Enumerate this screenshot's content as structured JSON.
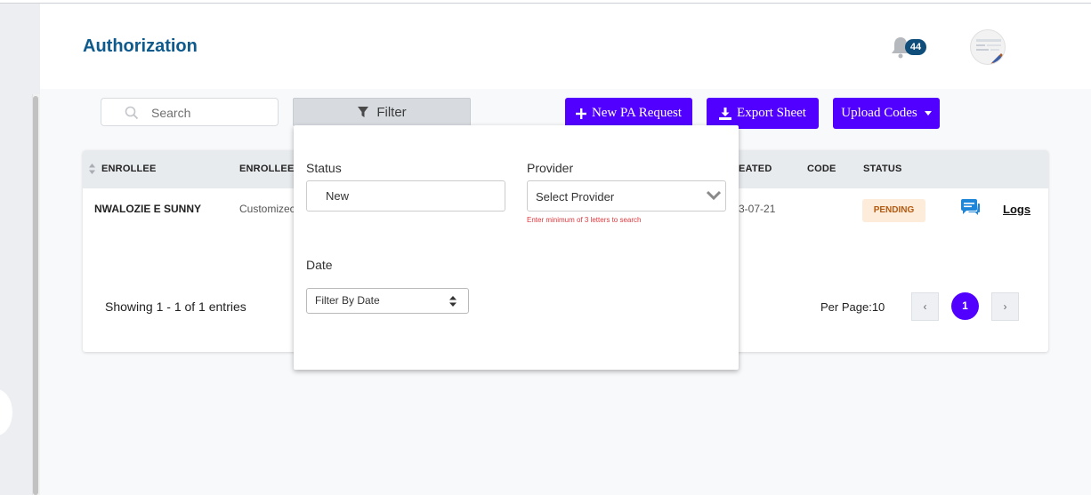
{
  "header": {
    "title": "Authorization",
    "notification_count": "44"
  },
  "toolbar": {
    "search_placeholder": "Search",
    "filter_label": "Filter",
    "new_pa_label": "New PA Request",
    "export_label": "Export Sheet",
    "upload_label": "Upload Codes"
  },
  "table": {
    "columns": [
      "ENROLLEE",
      "ENROLLEE I",
      "EATED",
      "CODE",
      "STATUS"
    ],
    "rows": [
      {
        "enrollee": "NWALOZIE E SUNNY",
        "enrollee_id": "Customizec",
        "created": "3-07-21",
        "code": "",
        "status": "PENDING",
        "action": "Logs"
      }
    ]
  },
  "pagination": {
    "entries_text": "Showing 1 - 1 of 1 entries",
    "per_page_text": "Per Page:10",
    "prev": "‹",
    "current": "1",
    "next": "›"
  },
  "filter_panel": {
    "status_label": "Status",
    "status_value": "New",
    "provider_label": "Provider",
    "provider_value": "Select Provider",
    "provider_hint": "Enter minimum of 3 letters to search",
    "date_label": "Date",
    "date_value": "Filter By Date"
  },
  "colors": {
    "accent": "#5100ff",
    "title": "#0f5a8c",
    "pending_bg": "#fdecd9",
    "pending_text": "#b35a10"
  },
  "icons": [
    "bell-icon",
    "avatar",
    "search-icon",
    "filter-icon",
    "plus-icon",
    "download-icon",
    "caret-down-icon",
    "sort-icon",
    "chat-icon",
    "chevron-down-icon",
    "updown-icon"
  ]
}
